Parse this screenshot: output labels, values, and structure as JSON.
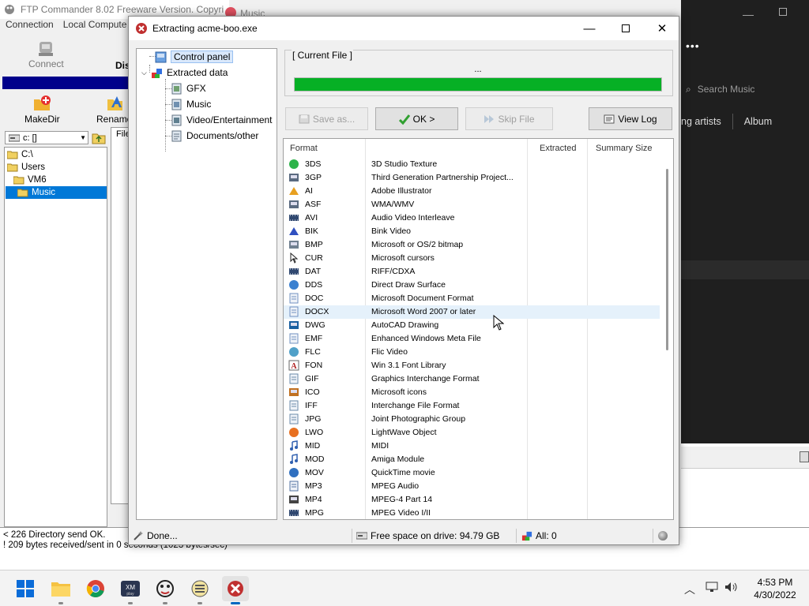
{
  "ftp": {
    "title": "FTP Commander 8.02  Freeware Version.  Copyri",
    "menu": [
      "Connection",
      "Local Compute"
    ],
    "connect_label": "Connect",
    "dis_label": "Dis",
    "makedir_label": "MakeDir",
    "rename_label": "Rename",
    "drive": "c: []",
    "files_header": "File",
    "tree": [
      "C:\\",
      "Users",
      "VM6",
      "Music"
    ],
    "log": [
      "< 226 Directory send OK.",
      "! 209 bytes received/sent in 0 seconds (1023 bytes/sec)"
    ]
  },
  "music": {
    "title": "Music",
    "search_placeholder": "Search Music",
    "tabs": [
      "ng artists",
      "Album"
    ],
    "more": "•••"
  },
  "dialog": {
    "title": "Extracting acme-boo.exe",
    "nav": {
      "control_panel": "Control panel",
      "extracted_data": "Extracted data",
      "children": [
        "GFX",
        "Music",
        "Video/Entertainment",
        "Documents/other"
      ]
    },
    "current_file_legend": "[ Current File ]",
    "current_file_name": "...",
    "progress": 1.0,
    "buttons": {
      "save_as": "Save as...",
      "ok": "OK >",
      "skip_file": "Skip File",
      "view_log": "View Log"
    },
    "columns": [
      "Format",
      "Extracted",
      "Summary Size"
    ],
    "rows": [
      {
        "ext": "3DS",
        "desc": "3D Studio Texture",
        "icon": "green-sphere-icon"
      },
      {
        "ext": "3GP",
        "desc": "Third Generation Partnership Project...",
        "icon": "media-file-icon"
      },
      {
        "ext": "AI",
        "desc": "Adobe Illustrator",
        "icon": "illustrator-icon"
      },
      {
        "ext": "ASF",
        "desc": "WMA/WMV",
        "icon": "media-file-icon"
      },
      {
        "ext": "AVI",
        "desc": "Audio Video Interleave",
        "icon": "film-icon"
      },
      {
        "ext": "BIK",
        "desc": "Bink Video",
        "icon": "bink-icon"
      },
      {
        "ext": "BMP",
        "desc": "Microsoft or OS/2 bitmap",
        "icon": "bitmap-icon"
      },
      {
        "ext": "CUR",
        "desc": "Microsoft cursors",
        "icon": "cursor-icon"
      },
      {
        "ext": "DAT",
        "desc": "RIFF/CDXA",
        "icon": "film-icon"
      },
      {
        "ext": "DDS",
        "desc": "Direct Draw Surface",
        "icon": "globe-icon"
      },
      {
        "ext": "DOC",
        "desc": "Microsoft Document Format",
        "icon": "document-icon"
      },
      {
        "ext": "DOCX",
        "desc": "Microsoft Word 2007 or later",
        "icon": "document-icon"
      },
      {
        "ext": "DWG",
        "desc": "AutoCAD Drawing",
        "icon": "autocad-icon"
      },
      {
        "ext": "EMF",
        "desc": "Enhanced Windows Meta File",
        "icon": "document-icon"
      },
      {
        "ext": "FLC",
        "desc": "Flic Video",
        "icon": "flic-icon"
      },
      {
        "ext": "FON",
        "desc": "Win 3.1 Font Library",
        "icon": "font-icon"
      },
      {
        "ext": "GIF",
        "desc": "Graphics Interchange Format",
        "icon": "image-file-icon"
      },
      {
        "ext": "ICO",
        "desc": "Microsoft icons",
        "icon": "icons-icon"
      },
      {
        "ext": "IFF",
        "desc": "Interchange File Format",
        "icon": "image-file-icon"
      },
      {
        "ext": "JPG",
        "desc": "Joint Photographic Group",
        "icon": "image-file-icon"
      },
      {
        "ext": "LWO",
        "desc": "LightWave Object",
        "icon": "lightwave-icon"
      },
      {
        "ext": "MID",
        "desc": "MIDI",
        "icon": "music-note-icon"
      },
      {
        "ext": "MOD",
        "desc": "Amiga Module",
        "icon": "music-note-icon"
      },
      {
        "ext": "MOV",
        "desc": "QuickTime movie",
        "icon": "quicktime-icon"
      },
      {
        "ext": "MP3",
        "desc": "MPEG Audio",
        "icon": "audio-file-icon"
      },
      {
        "ext": "MP4",
        "desc": "MPEG-4 Part 14",
        "icon": "mp4-icon"
      },
      {
        "ext": "MPG",
        "desc": "MPEG Video I/II",
        "icon": "film-icon"
      }
    ],
    "status": {
      "done": "Done...",
      "free_space": "Free space on drive: 94.79 GB",
      "all": "All: 0"
    }
  },
  "taskbar": {
    "time": "4:53 PM",
    "date": "4/30/2022"
  }
}
